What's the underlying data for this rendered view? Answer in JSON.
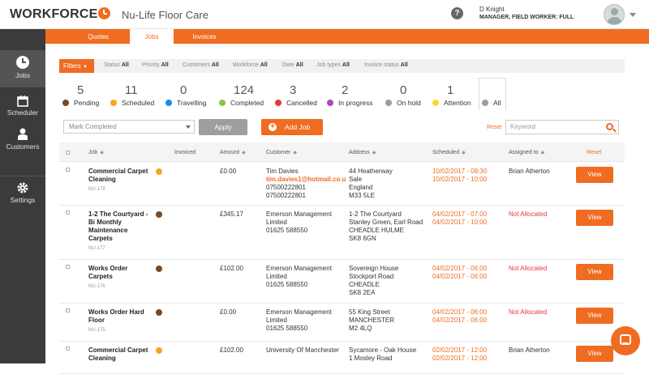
{
  "header": {
    "logo": "WORKFORCE",
    "company": "Nu-Life Floor Care",
    "help_icon": "question-icon",
    "user_name": "D Knight",
    "user_role": "MANAGER, FIELD WORKER: FULL"
  },
  "sidebar": {
    "items": [
      {
        "label": "Jobs",
        "icon": "clock-icon"
      },
      {
        "label": "Scheduler",
        "icon": "calendar-icon"
      },
      {
        "label": "Customers",
        "icon": "person-icon"
      },
      {
        "label": "Settings",
        "icon": "gear-icon"
      }
    ]
  },
  "tabs": [
    {
      "label": "Quotes"
    },
    {
      "label": "Jobs"
    },
    {
      "label": "Invoices"
    }
  ],
  "filters": {
    "button": "Filters",
    "items": [
      {
        "label": "Status",
        "value": "All"
      },
      {
        "label": "Priority",
        "value": "All"
      },
      {
        "label": "Customers",
        "value": "All"
      },
      {
        "label": "Workforce",
        "value": "All"
      },
      {
        "label": "Date",
        "value": "All"
      },
      {
        "label": "Job types",
        "value": "All"
      },
      {
        "label": "Invoice status",
        "value": "All"
      }
    ]
  },
  "statuses": [
    {
      "count": "5",
      "label": "Pending",
      "color": "#7b4a1e"
    },
    {
      "count": "11",
      "label": "Scheduled",
      "color": "#f5a623"
    },
    {
      "count": "0",
      "label": "Travelling",
      "color": "#1e88e5"
    },
    {
      "count": "124",
      "label": "Completed",
      "color": "#8bc34a"
    },
    {
      "count": "3",
      "label": "Cancelled",
      "color": "#e53935"
    },
    {
      "count": "2",
      "label": "In progress",
      "color": "#ab47bc"
    },
    {
      "count": "0",
      "label": "On hold",
      "color": "#9e9e9e"
    },
    {
      "count": "1",
      "label": "Attention",
      "color": "#fdd835"
    },
    {
      "count": "",
      "label": "All",
      "color": "#9e9e9e"
    }
  ],
  "actions": {
    "mark_placeholder": "Mark Completed",
    "apply": "Apply",
    "add_job": "Add Job",
    "reset": "Reset",
    "keyword_placeholder": "Keyword"
  },
  "table": {
    "columns": [
      "Job",
      "Invoiced",
      "Amount",
      "Customer",
      "Address",
      "Scheduled",
      "Assigned to"
    ],
    "reset": "Reset",
    "rows": [
      {
        "title": [
          "Commercial Carpet",
          "Cleaning"
        ],
        "number": "NU-178",
        "dot": "#f5a623",
        "amount": "£0.00",
        "customer": [
          "Tim Davies",
          "tim.davies1@hotmail.co.u",
          "07500222801",
          "07500222801"
        ],
        "email_line": 1,
        "address": [
          "44 Heatherway",
          "Sale",
          "England",
          "M33 5LE"
        ],
        "scheduled": [
          "10/02/2017 - 08:30",
          "10/02/2017 - 10:00"
        ],
        "assigned": "Brian Atherton",
        "unallocated": false,
        "view": "View"
      },
      {
        "title": [
          "1-2 The Courtyard -",
          "Bi Monthly",
          "Maintenance",
          "Carpets"
        ],
        "number": "NU-177",
        "dot": "#7b4a1e",
        "amount": "£345.17",
        "customer": [
          "Emerson Management",
          "Limited",
          "01625 588550"
        ],
        "email_line": -1,
        "address": [
          "1-2 The Courtyard",
          "Stanley Green, Earl Road",
          "CHEADLE HULME",
          "SK8 6GN"
        ],
        "scheduled": [
          "04/02/2017 - 07:00",
          "04/02/2017 - 10:00"
        ],
        "assigned": "Not Allocated",
        "unallocated": true,
        "view": "View"
      },
      {
        "title": [
          "Works Order",
          "Carpets"
        ],
        "number": "NU-176",
        "dot": "#7b4a1e",
        "amount": "£102.00",
        "customer": [
          "Emerson Management",
          "Limited",
          "01625 588550"
        ],
        "email_line": -1,
        "address": [
          "Sovereign House",
          "Stockport Road",
          "CHEADLE",
          "SK8 2EA"
        ],
        "scheduled": [
          "04/02/2017 - 06:00",
          "04/02/2017 - 06:00"
        ],
        "assigned": "Not Allocated",
        "unallocated": true,
        "view": "View"
      },
      {
        "title": [
          "Works Order Hard",
          "Floor"
        ],
        "number": "NU-175",
        "dot": "#7b4a1e",
        "amount": "£0.00",
        "customer": [
          "Emerson Management",
          "Limited",
          "01625 588550"
        ],
        "email_line": -1,
        "address": [
          "55 King Street",
          "MANCHESTER",
          "M2 4LQ"
        ],
        "scheduled": [
          "04/02/2017 - 06:00",
          "04/02/2017 - 06:00"
        ],
        "assigned": "Not Allocated",
        "unallocated": true,
        "view": "View"
      },
      {
        "title": [
          "Commercial Carpet",
          "Cleaning"
        ],
        "number": "",
        "dot": "#f5a623",
        "amount": "£102.00",
        "customer": [
          "University Of Manchester"
        ],
        "email_line": -1,
        "address": [
          "Sycamore - Oak House",
          "1 Mosley Road"
        ],
        "scheduled": [
          "02/02/2017 - 12:00",
          "02/02/2017 - 12:00"
        ],
        "assigned": "Brian Atherton",
        "unallocated": false,
        "view": "View"
      }
    ]
  },
  "chat_icon": "chat-icon"
}
